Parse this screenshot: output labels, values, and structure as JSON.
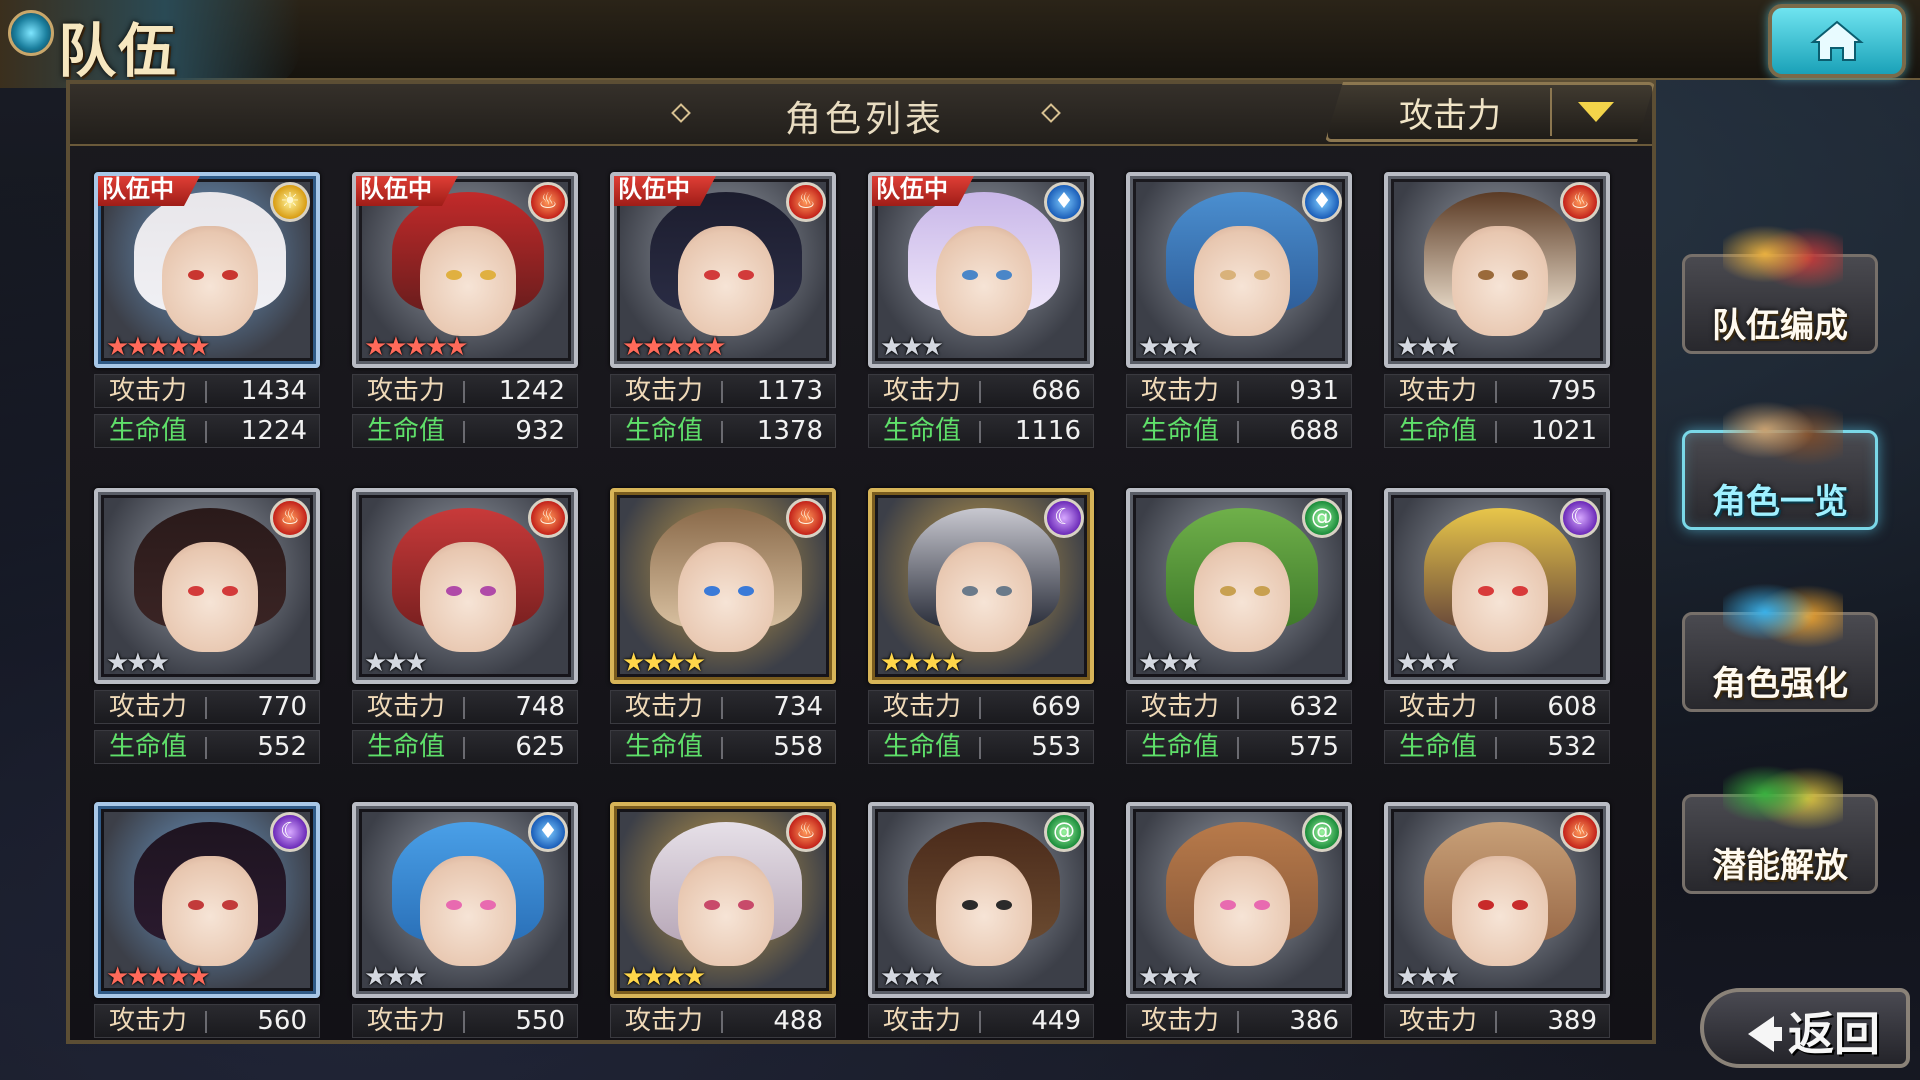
{
  "screen": {
    "title": "队伍"
  },
  "panel": {
    "title": "角色列表",
    "sort_value": "攻击力"
  },
  "labels": {
    "atk": "攻击力",
    "hp": "生命值",
    "in_team": "队伍中"
  },
  "colors": {
    "atk_label": "#efd9b8",
    "hp_label": "#5fe06a",
    "team_badge": "#c8261e",
    "active_glow": "#7ad8e8"
  },
  "icons": {
    "fire": "fire-element-icon",
    "water": "water-element-icon",
    "light": "light-element-icon",
    "dark": "dark-element-icon",
    "wind": "wind-element-icon"
  },
  "cards": [
    {
      "in_team": true,
      "element": "light",
      "stars": 5,
      "star_color": "red",
      "frame": "blue",
      "atk": "1434",
      "hp": "1224"
    },
    {
      "in_team": true,
      "element": "fire",
      "stars": 5,
      "star_color": "red",
      "frame": "silver",
      "atk": "1242",
      "hp": "932"
    },
    {
      "in_team": true,
      "element": "fire",
      "stars": 5,
      "star_color": "red",
      "frame": "silver",
      "atk": "1173",
      "hp": "1378"
    },
    {
      "in_team": true,
      "element": "water",
      "stars": 3,
      "star_color": "silver",
      "frame": "silver",
      "atk": "686",
      "hp": "1116"
    },
    {
      "in_team": false,
      "element": "water",
      "stars": 3,
      "star_color": "silver",
      "frame": "silver",
      "atk": "931",
      "hp": "688"
    },
    {
      "in_team": false,
      "element": "fire",
      "stars": 3,
      "star_color": "silver",
      "frame": "silver",
      "atk": "795",
      "hp": "1021"
    },
    {
      "in_team": false,
      "element": "fire",
      "stars": 3,
      "star_color": "silver",
      "frame": "silver",
      "atk": "770",
      "hp": "552"
    },
    {
      "in_team": false,
      "element": "fire",
      "stars": 3,
      "star_color": "silver",
      "frame": "silver",
      "atk": "748",
      "hp": "625"
    },
    {
      "in_team": false,
      "element": "fire",
      "stars": 4,
      "star_color": "gold",
      "frame": "gold",
      "atk": "734",
      "hp": "558"
    },
    {
      "in_team": false,
      "element": "dark",
      "stars": 4,
      "star_color": "gold",
      "frame": "gold",
      "atk": "669",
      "hp": "553"
    },
    {
      "in_team": false,
      "element": "wind",
      "stars": 3,
      "star_color": "silver",
      "frame": "silver",
      "atk": "632",
      "hp": "575"
    },
    {
      "in_team": false,
      "element": "dark",
      "stars": 3,
      "star_color": "silver",
      "frame": "silver",
      "atk": "608",
      "hp": "532"
    },
    {
      "in_team": false,
      "element": "dark",
      "stars": 5,
      "star_color": "red",
      "frame": "blue",
      "atk": "560",
      "hp": ""
    },
    {
      "in_team": false,
      "element": "water",
      "stars": 3,
      "star_color": "silver",
      "frame": "silver",
      "atk": "550",
      "hp": ""
    },
    {
      "in_team": false,
      "element": "fire",
      "stars": 4,
      "star_color": "gold",
      "frame": "gold",
      "atk": "488",
      "hp": ""
    },
    {
      "in_team": false,
      "element": "wind",
      "stars": 3,
      "star_color": "silver",
      "frame": "silver",
      "atk": "449",
      "hp": ""
    },
    {
      "in_team": false,
      "element": "wind",
      "stars": 3,
      "star_color": "silver",
      "frame": "silver",
      "atk": "386",
      "hp": ""
    },
    {
      "in_team": false,
      "element": "fire",
      "stars": 3,
      "star_color": "silver",
      "frame": "silver",
      "atk": "389",
      "hp": ""
    }
  ],
  "side_menu": [
    {
      "label": "队伍编成",
      "active": false
    },
    {
      "label": "角色一览",
      "active": true
    },
    {
      "label": "角色强化",
      "active": false
    },
    {
      "label": "潜能解放",
      "active": false
    }
  ],
  "back": {
    "label": "返回"
  }
}
